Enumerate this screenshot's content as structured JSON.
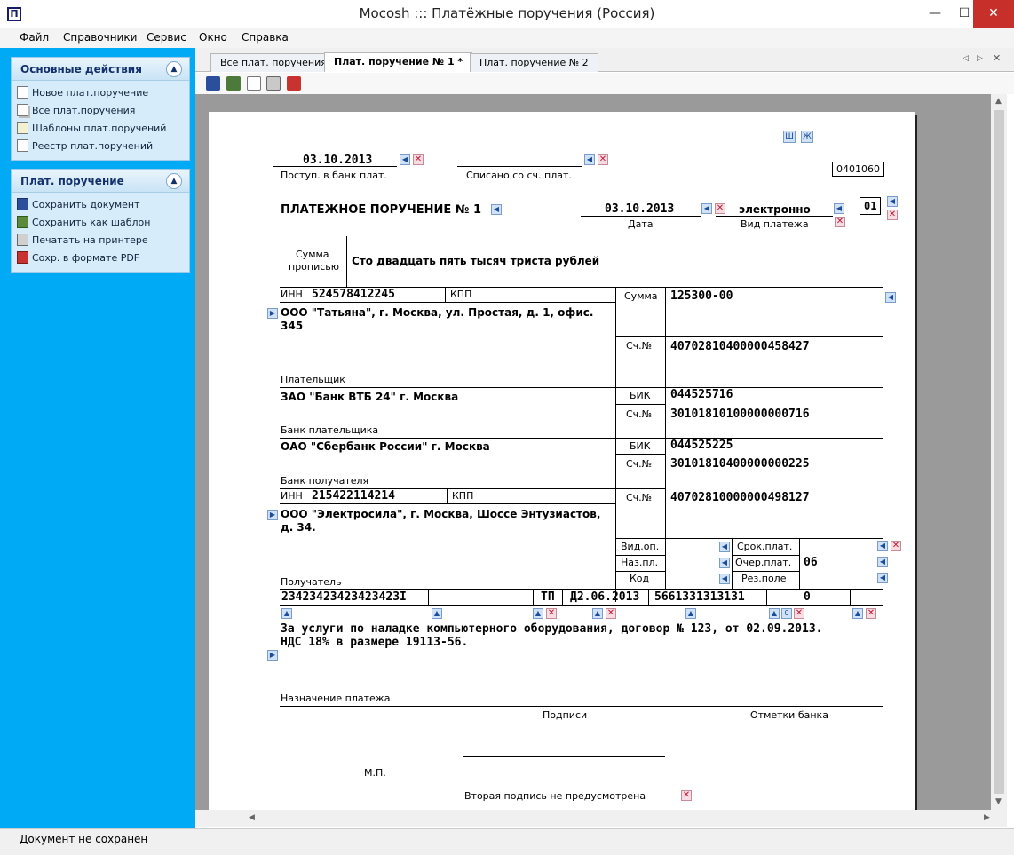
{
  "window": {
    "title": "Mocosh ::: Платёжные поручения (Россия)",
    "icon_char": "П",
    "min": "—",
    "max": "☐",
    "close": "✕"
  },
  "menu": [
    "Файл",
    "Справочники",
    "Сервис",
    "Окно",
    "Справка"
  ],
  "left_panel": {
    "group1": {
      "title": "Основные действия",
      "items": [
        "Новое плат.поручение",
        "Все плат.поручения",
        "Шаблоны плат.поручений",
        "Реестр плат.поручений"
      ]
    },
    "group2": {
      "title": "Плат. поручение",
      "items": [
        "Сохранить документ",
        "Сохранить как шаблон",
        "Печатать на принтере",
        "Сохр. в формате PDF"
      ]
    }
  },
  "tabs": [
    "Все плат. поручения",
    "Плат. поручение № 1 *",
    "Плат. поручение № 2"
  ],
  "toolbar": [
    "save-icon",
    "save-template-icon",
    "print-preview-icon",
    "print-icon",
    "pdf-icon"
  ],
  "doc": {
    "font_buttons": [
      "Ш",
      "Ж"
    ],
    "received_date": "03.10.2013",
    "received_label": "Поступ. в банк плат.",
    "debited_label": "Списано со сч. плат.",
    "form_code": "0401060",
    "title": "ПЛАТЕЖНОЕ ПОРУЧЕНИЕ № 1",
    "date": "03.10.2013",
    "date_label": "Дата",
    "payment_type": "электронно",
    "payment_type_label": "Вид платежа",
    "status_code": "01",
    "amount_words_label1": "Сумма",
    "amount_words_label2": "прописью",
    "amount_words": "Сто двадцать пять тысяч триста рублей",
    "inn_label": "ИНН",
    "payer_inn": "524578412245",
    "kpp_label": "КПП",
    "sum_label": "Сумма",
    "amount": "125300-00",
    "payer_name_line1": "ООО \"Татьяна\", г. Москва, ул. Простая, д. 1, офис.",
    "payer_name_line2": "345",
    "account_label": "Сч.№",
    "payer_account": "40702810400000458427",
    "payer_label": "Плательщик",
    "payer_bank": "ЗАО \"Банк ВТБ 24\" г. Москва",
    "bik_label": "БИК",
    "payer_bik": "044525716",
    "payer_corr_account": "30101810100000000716",
    "payer_bank_label": "Банк плательщика",
    "payee_bank": "ОАО \"Сбербанк России\"  г. Москва",
    "payee_bik": "044525225",
    "payee_corr_account": "30101810400000000225",
    "payee_bank_label": "Банк получателя",
    "payee_inn": "215422114214",
    "payee_account": "40702810000000498127",
    "payee_name_line1": "ООО \"Электросила\", г. Москва, Шоссе Энтузиастов,",
    "payee_name_line2": "д. 34.",
    "vid_op_label": "Вид.оп.",
    "naz_pl_label": "Наз.пл.",
    "kod_label": "Код",
    "srok_label": "Срок.плат.",
    "ocher_label": "Очер.плат.",
    "ocher_value": "06",
    "rez_label": "Рез.поле",
    "payee_label": "Получатель",
    "kbk": "23423423423423423I",
    "tax_basis": "ТП",
    "tax_period": "Д2.06.2013",
    "doc_number": "5661331313131",
    "doc_date": "0",
    "zero_btn": "0",
    "purpose_line1": "За услуги по наладке компьютерного оборудования, договор № 123, от 02.09.2013.",
    "purpose_line2": "НДС 18% в размере 19113-56.",
    "purpose_label": "Назначение платежа",
    "signatures_label": "Подписи",
    "bank_marks_label": "Отметки банка",
    "mp_label": "М.П.",
    "second_signature": "Вторая подпись не предусмотрена"
  },
  "status": "Документ не сохранен",
  "colors": {
    "left_panel": "#00aaf5",
    "close_button": "#c7302a",
    "group_bg": "#d6ecfa"
  }
}
